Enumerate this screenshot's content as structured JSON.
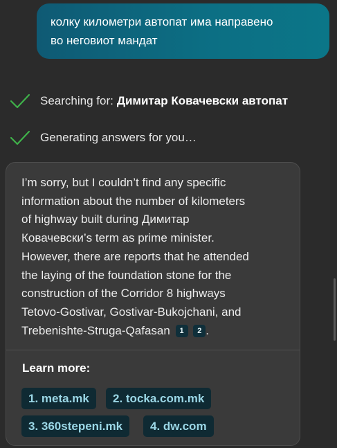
{
  "user_message": {
    "line1": "колку километри автопат има направено",
    "line2": "во неговиот мандат"
  },
  "status": {
    "searching_prefix": "Searching for:",
    "searching_query": "Димитар Ковачевски автопат",
    "generating": "Generating answers for you…"
  },
  "answer": {
    "lines": [
      "I’m sorry, but I couldn’t find any specific",
      "information about the number of kilometers",
      "of highway built during Димитар",
      "Ковачевски’s term as prime minister.",
      "However, there are reports that he attended",
      "the laying of the foundation stone for the",
      "construction of the Corridor 8 highways",
      "Tetovo-Gostivar, Gostivar-Bukojchani, and",
      "Trebenishte-Struga-Qafasan"
    ],
    "citations": [
      "1",
      "2"
    ],
    "end_punct": "."
  },
  "learn_more": {
    "label": "Learn more:",
    "links": [
      "1. meta.mk",
      "2. tocka.com.mk",
      "3. 360stepeni.mk",
      "4. dw.com"
    ]
  },
  "colors": {
    "accent_check": "#3fb24a",
    "bubble": "#0c6f84",
    "chip_bg": "#0f2a33",
    "chip_text": "#9bd7e6"
  },
  "icons": {
    "status_check": "checkmark-icon"
  }
}
